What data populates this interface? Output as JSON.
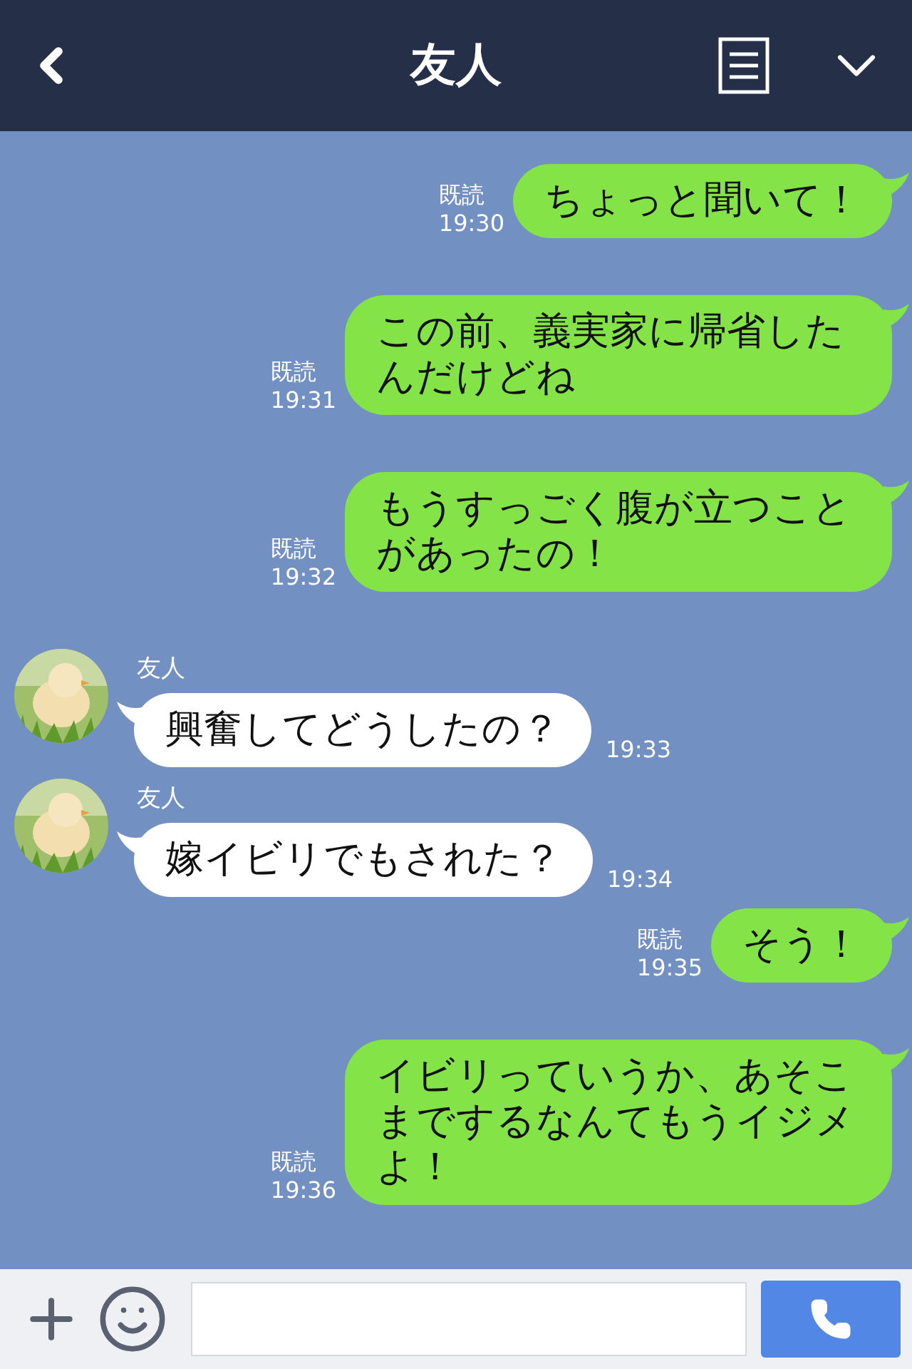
{
  "header": {
    "title": "友人"
  },
  "messages": [
    {
      "kind": "sent",
      "text": "ちょっと聞いて！",
      "read": "既読",
      "time": "19:30"
    },
    {
      "kind": "sent",
      "text": "この前、義実家に帰省したんだけどね",
      "read": "既読",
      "time": "19:31"
    },
    {
      "kind": "sent",
      "text": "もうすっごく腹が立つことがあったの！",
      "read": "既読",
      "time": "19:32"
    },
    {
      "kind": "received",
      "name": "友人",
      "text": "興奮してどうしたの？",
      "time": "19:33"
    },
    {
      "kind": "received",
      "name": "友人",
      "text": "嫁イビリでもされた？",
      "time": "19:34"
    },
    {
      "kind": "sent",
      "text": "そう！",
      "read": "既読",
      "time": "19:35"
    },
    {
      "kind": "sent",
      "text": "イビリっていうか、あそこまでするなんてもうイジメよ！",
      "read": "既読",
      "time": "19:36"
    }
  ]
}
